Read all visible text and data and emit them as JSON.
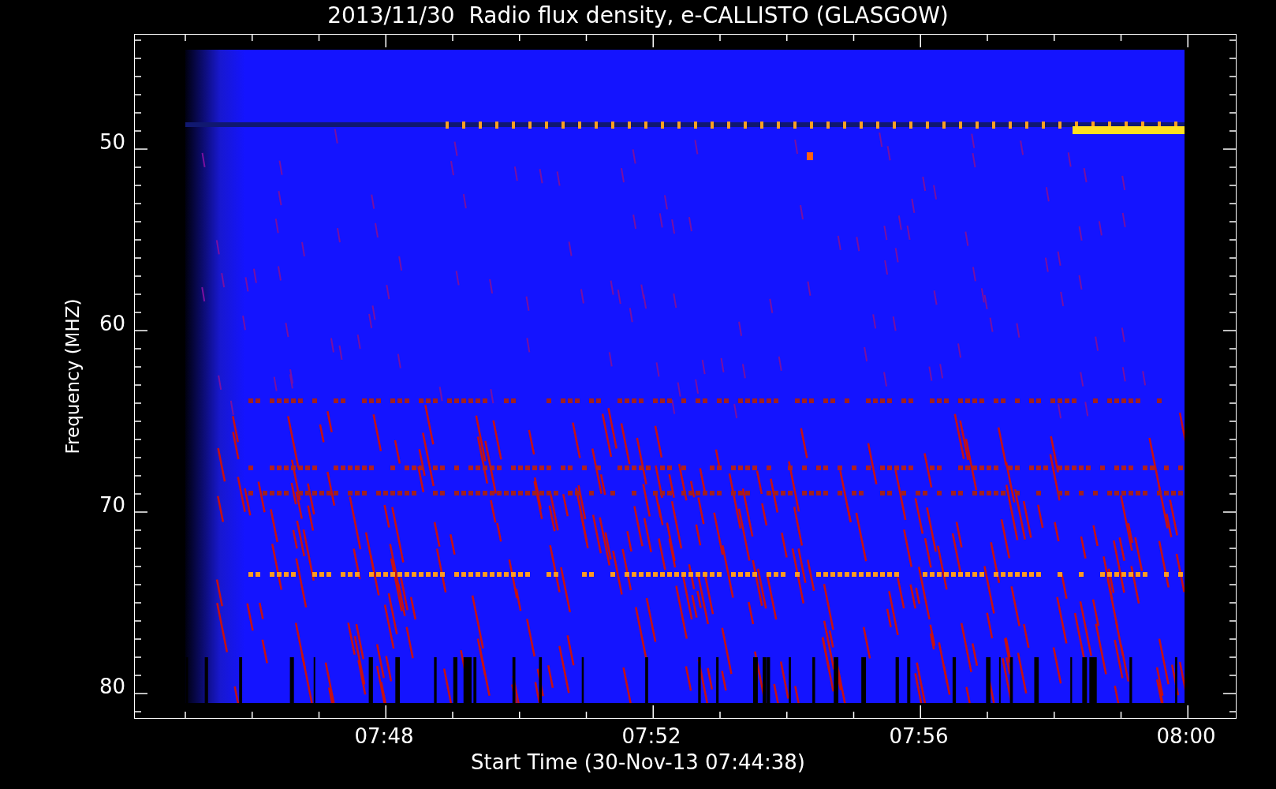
{
  "title": "2013/11/30  Radio flux density, e-CALLISTO (GLASGOW)",
  "ylabel": "Frequency (MHZ)",
  "xlabel": "Start Time (30-Nov-13 07:44:38)",
  "yticks": [
    "50",
    "60",
    "70",
    "80"
  ],
  "xticks": [
    "07:48",
    "07:52",
    "07:56",
    "08:00"
  ]
}
